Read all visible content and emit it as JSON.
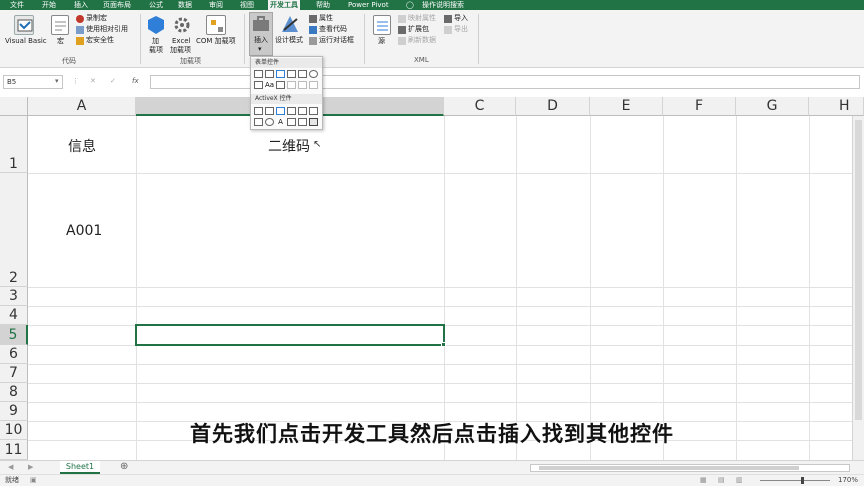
{
  "tabs": [
    "文件",
    "开始",
    "插入",
    "页面布局",
    "公式",
    "数据",
    "审阅",
    "视图",
    "开发工具",
    "帮助",
    "Power Pivot",
    "操作说明搜索"
  ],
  "active_tab": "开发工具",
  "ribbon": {
    "code": {
      "visual_basic": "Visual Basic",
      "macros": "宏",
      "record_macro": "录制宏",
      "relative_ref": "使用相对引用",
      "macro_security": "宏安全性",
      "label": "代码"
    },
    "addins": {
      "addins": "加载项",
      "addins_line1": "加",
      "addins_line2": "载项",
      "excel_addins_line1": "Excel",
      "excel_addins_line2": "加载项",
      "com_addins": "COM 加载项",
      "label": "加载项"
    },
    "controls": {
      "insert": "插入",
      "design_mode": "设计模式",
      "properties": "属性",
      "view_code": "查看代码",
      "run_dialog": "运行对话框"
    },
    "xml": {
      "source": "源",
      "map_props": "映射属性",
      "expansion": "扩展包",
      "refresh": "刷新数据",
      "import": "导入",
      "export": "导出",
      "label": "XML"
    }
  },
  "dropdown": {
    "form_controls": "表单控件",
    "activex_controls": "ActiveX 控件"
  },
  "formula_bar": {
    "name_box": "B5",
    "fx": "fx",
    "value": ""
  },
  "columns": [
    "A",
    "B",
    "C",
    "D",
    "E",
    "F",
    "G",
    "H"
  ],
  "rows": [
    "1",
    "2",
    "3",
    "4",
    "5",
    "6",
    "7",
    "8",
    "9",
    "10",
    "11"
  ],
  "cells": {
    "A1": "信息",
    "B1": "二维码",
    "A2": "A001"
  },
  "selected_cell": "B5",
  "subtitle": "首先我们点击开发工具然后点击插入找到其他控件",
  "sheet_tab": "Sheet1",
  "status": {
    "mode": "就绪",
    "zoom": "170%"
  },
  "colors": {
    "accent": "#217346",
    "ribbon_bg": "#f3f3f3"
  }
}
